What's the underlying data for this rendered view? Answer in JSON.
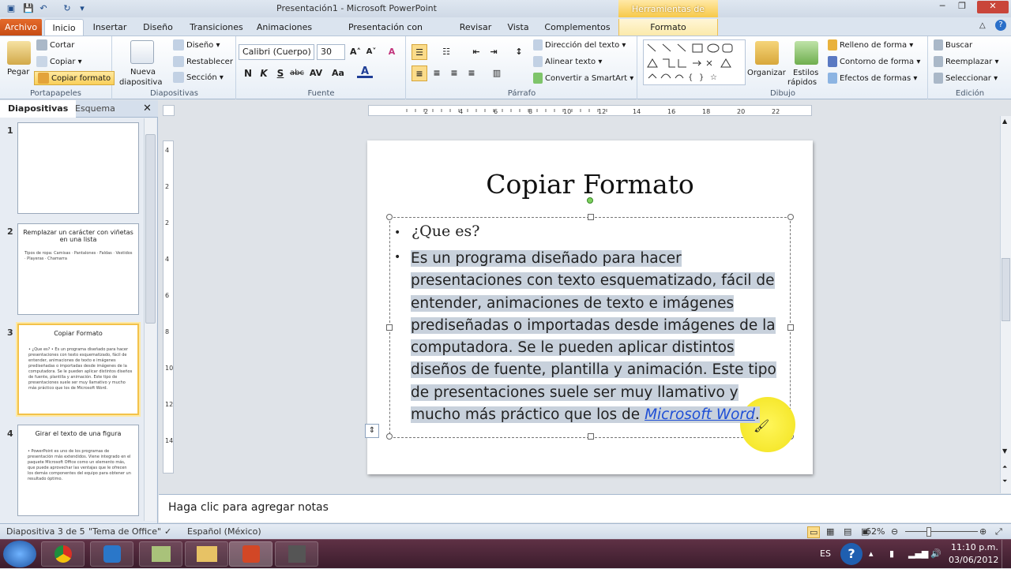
{
  "window": {
    "title": "Presentación1  -  Microsoft PowerPoint",
    "context_tab_group": "Herramientas de dibujo"
  },
  "tabs": [
    "Archivo",
    "Inicio",
    "Insertar",
    "Diseño",
    "Transiciones",
    "Animaciones",
    "Presentación con diapositivas",
    "Revisar",
    "Vista",
    "Complementos",
    "Formato"
  ],
  "ribbon": {
    "portapapeles": {
      "label": "Portapapeles",
      "pegar": "Pegar",
      "cortar": "Cortar",
      "copiar": "Copiar",
      "copiar_formato": "Copiar formato"
    },
    "diapositivas": {
      "label": "Diapositivas",
      "nueva": "Nueva",
      "diapositiva": "diapositiva",
      "diseno": "Diseño",
      "restablecer": "Restablecer",
      "seccion": "Sección"
    },
    "fuente": {
      "label": "Fuente",
      "font_name": "Calibri (Cuerpo)",
      "font_size": "30",
      "bold": "N",
      "italic": "K",
      "underline": "S",
      "strike": "abc"
    },
    "parrafo": {
      "label": "Párrafo",
      "direccion": "Dirección del texto",
      "alinear": "Alinear texto",
      "smartart": "Convertir a SmartArt"
    },
    "dibujo": {
      "label": "Dibujo",
      "organizar": "Organizar",
      "estilos": "Estilos",
      "rapidos": "rápidos",
      "relleno": "Relleno de forma",
      "contorno": "Contorno de forma",
      "efectos": "Efectos de formas"
    },
    "edicion": {
      "label": "Edición",
      "buscar": "Buscar",
      "reemplazar": "Reemplazar",
      "seleccionar": "Seleccionar"
    }
  },
  "panel": {
    "tab_slides": "Diapositivas",
    "tab_outline": "Esquema",
    "thumbs": [
      {
        "num": "1",
        "title": "",
        "body": ""
      },
      {
        "num": "2",
        "title": "Remplazar un carácter con viñetas en una lista",
        "body": "Tipos de ropa: Camisas · Pantalones · Faldas · Vestidos · Playeras · Chamarra"
      },
      {
        "num": "3",
        "title": "Copiar Formato",
        "body": "• ¿Que es? • Es un programa diseñado para hacer presentaciones con texto esquematizado, fácil de entender, animaciones de texto e imágenes prediseñadas o importadas desde imágenes de la computadora. Se le pueden aplicar distintos diseños de fuente, plantilla y animación. Este tipo de presentaciones suele ser muy llamativo y mucho más práctico que los de Microsoft Word."
      },
      {
        "num": "4",
        "title": "Girar el texto de una figura",
        "body": "• PowerPoint es uno de los programas de presentación más extendidos. Viene integrado en el paquete Microsoft Office como un elemento más, que puede aprovechar las ventajas que le ofrecen los demás componentes del equipo para obtener un resultado óptimo."
      }
    ]
  },
  "ruler": {
    "h_ticks": [
      "2",
      "4",
      "6",
      "8",
      "10",
      "12",
      "14",
      "16",
      "18",
      "20",
      "22"
    ],
    "v_ticks": [
      "4",
      "2",
      "2",
      "4",
      "6",
      "8",
      "10",
      "12",
      "14"
    ]
  },
  "slide": {
    "title": "Copiar Formato",
    "bullet1": "¿Que es?",
    "body_pre": "Es un programa diseñado para hacer presentaciones con texto esquematizado, fácil de entender, animaciones de texto e imágenes prediseñadas o importadas desde imágenes de la computadora. Se le pueden aplicar distintos diseños de fuente, plantilla y animación. Este tipo de presentaciones suele ser muy llamativo y mucho más práctico que los de ",
    "body_link": "Microsoft Word",
    "body_post": "."
  },
  "notes_placeholder": "Haga clic para agregar notas",
  "status": {
    "slide_info": "Diapositiva 3 de 5",
    "theme": "\"Tema de Office\"",
    "language": "Español (México)",
    "zoom": "62%"
  },
  "taskbar": {
    "lang": "ES",
    "time": "11:10 p.m.",
    "date": "03/06/2012"
  },
  "colors": {
    "accent": "#c54b14",
    "selection": "#c8d1dc",
    "link": "#1f4fd6",
    "spotlight": "#f2e21c"
  }
}
